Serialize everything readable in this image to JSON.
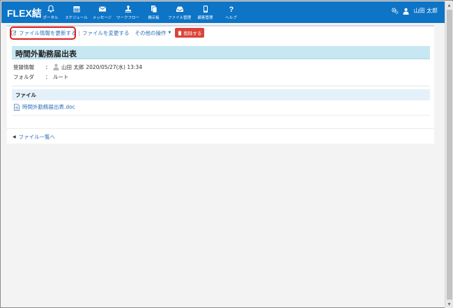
{
  "app": {
    "logo": "FLEX結"
  },
  "nav": [
    {
      "label": "ポータル",
      "icon": "bell-icon"
    },
    {
      "label": "スケジュール",
      "icon": "calendar-icon"
    },
    {
      "label": "メッセージ",
      "icon": "envelope-icon"
    },
    {
      "label": "ワークフロー",
      "icon": "stamp-icon"
    },
    {
      "label": "掲示板",
      "icon": "board-icon"
    },
    {
      "label": "ファイル管理",
      "icon": "inbox-icon"
    },
    {
      "label": "顧客管理",
      "icon": "phone-icon"
    },
    {
      "label": "ヘルプ",
      "icon": "question-icon"
    }
  ],
  "user": {
    "name": "山田 太郎"
  },
  "toolbar": {
    "update_info": "ファイル情報を更新する",
    "change_file": "ファイルを変更する",
    "other_ops": "その他の操作",
    "delete": "削除する"
  },
  "document": {
    "title": "時間外勤務届出表",
    "registration_label": "登録情報",
    "registration_user": "山田 太郎",
    "registration_date": "2020/05/27(水) 13:34",
    "folder_label": "フォルダ",
    "folder_value": "ルート",
    "colon": "："
  },
  "file_section": {
    "header": "ファイル",
    "file_name": "時間外勤務届出表.doc"
  },
  "back_link": "ファイル一覧へ",
  "colors": {
    "topbar": "#0d74c6",
    "title_bg": "#c7e8f2",
    "link": "#2a6fb8",
    "delete": "#d9443a",
    "highlight": "#e0201e"
  }
}
